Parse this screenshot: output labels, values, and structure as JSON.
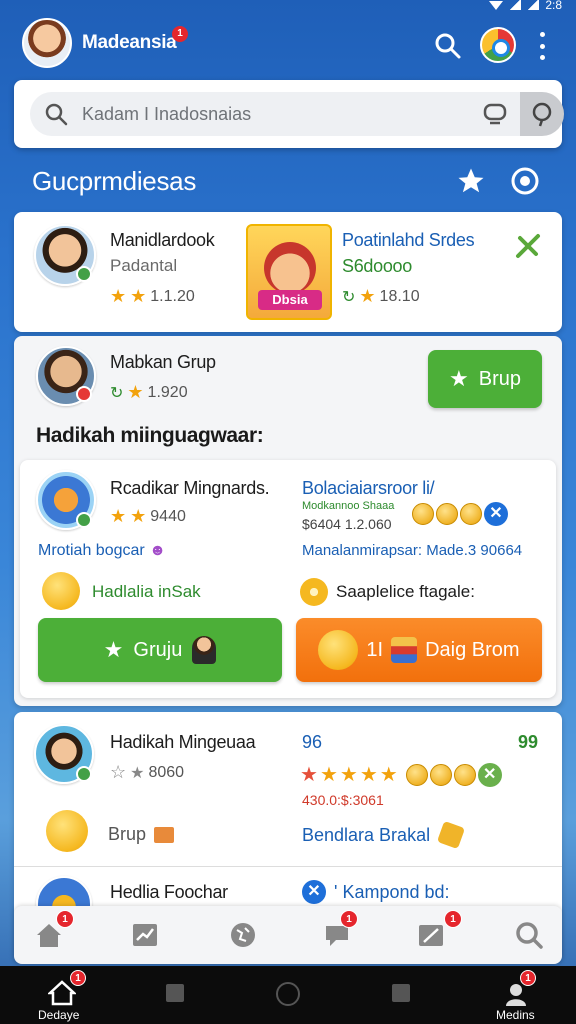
{
  "status_bar": {
    "time": "2:8"
  },
  "header": {
    "title": "Madeansia",
    "badge": "1"
  },
  "search": {
    "placeholder": "Kadam I Inadosnaias"
  },
  "section": {
    "title": "Gucprmdiesas"
  },
  "card1": {
    "name": "Manidlardook",
    "subtitle": "Padantal",
    "rating": "1.1.20",
    "game_tag": "Dbsia",
    "right_title": "Poatinlahd Srdes",
    "right_sub": "S6doooo",
    "right_rating": "18.10"
  },
  "card2": {
    "name": "Mabkan Grup",
    "rating": "1.920",
    "button_label": "Brup",
    "heading": "Hadikah miinguagwaar:",
    "inner": {
      "name": "Rcadikar Mingnards.",
      "rating": "9440",
      "right_title": "Bolaciaiarsroor li/",
      "right_meta1": "Modkannoo Shaaa",
      "right_meta2": "$6404 1.2.060",
      "left_link": "Mrotiah bogcar",
      "right_link": "Manalanmirapsar: Made.3 90664",
      "left_emoji_text": "Hadlalia inSak",
      "right_emoji_text": "Saaplelice ftagale:",
      "green_button": "Gruju",
      "orange_button": "Daig Brom",
      "orange_prefix": "1I"
    }
  },
  "card3": {
    "name": "Hadikah Mingeuaa",
    "rating": "8060",
    "num_left": "96",
    "num_right": "99",
    "price": "430.0:$:3061",
    "brup": "Brup",
    "brakal": "Bendlara Brakal",
    "partial_name": "Hedlia Foochar",
    "partial_right": "' Kampond bd:"
  },
  "bottom_nav": {
    "badges": [
      "1",
      "1",
      "1"
    ]
  },
  "sys_nav": {
    "left_label": "Dedaye",
    "right_label": "Medins",
    "left_badge": "1",
    "right_badge": "1"
  },
  "colors": {
    "primary_blue": "#1f5fb8",
    "green": "#4caf38",
    "orange": "#f2700c",
    "badge_red": "#e5262d"
  }
}
